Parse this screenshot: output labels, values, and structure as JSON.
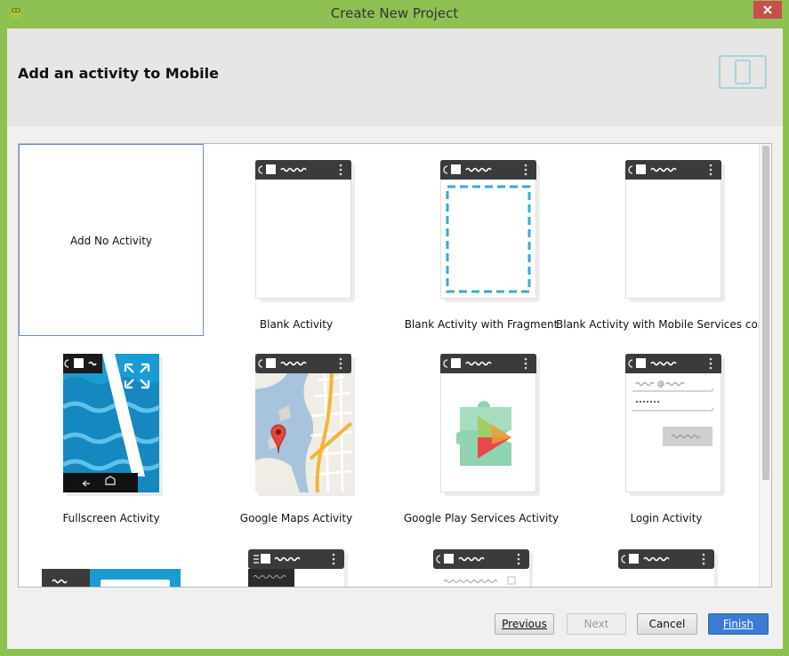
{
  "window": {
    "title": "Create New Project"
  },
  "header": {
    "title": "Add an activity to Mobile"
  },
  "gallery": {
    "items": [
      {
        "label": "Add No Activity",
        "selected": true
      },
      {
        "label": "Blank Activity"
      },
      {
        "label": "Blank Activity with Fragment"
      },
      {
        "label": "Blank Activity with Mobile Services connect"
      },
      {
        "label": "Fullscreen Activity"
      },
      {
        "label": "Google Maps Activity"
      },
      {
        "label": "Google Play Services Activity"
      },
      {
        "label": "Login Activity"
      }
    ]
  },
  "buttons": {
    "previous": "Previous",
    "next": "Next",
    "cancel": "Cancel",
    "finish": "Finish"
  },
  "colors": {
    "frame": "#8ec152",
    "accent": "#3a7bd5",
    "fragment_dash": "#3aa8d8"
  }
}
